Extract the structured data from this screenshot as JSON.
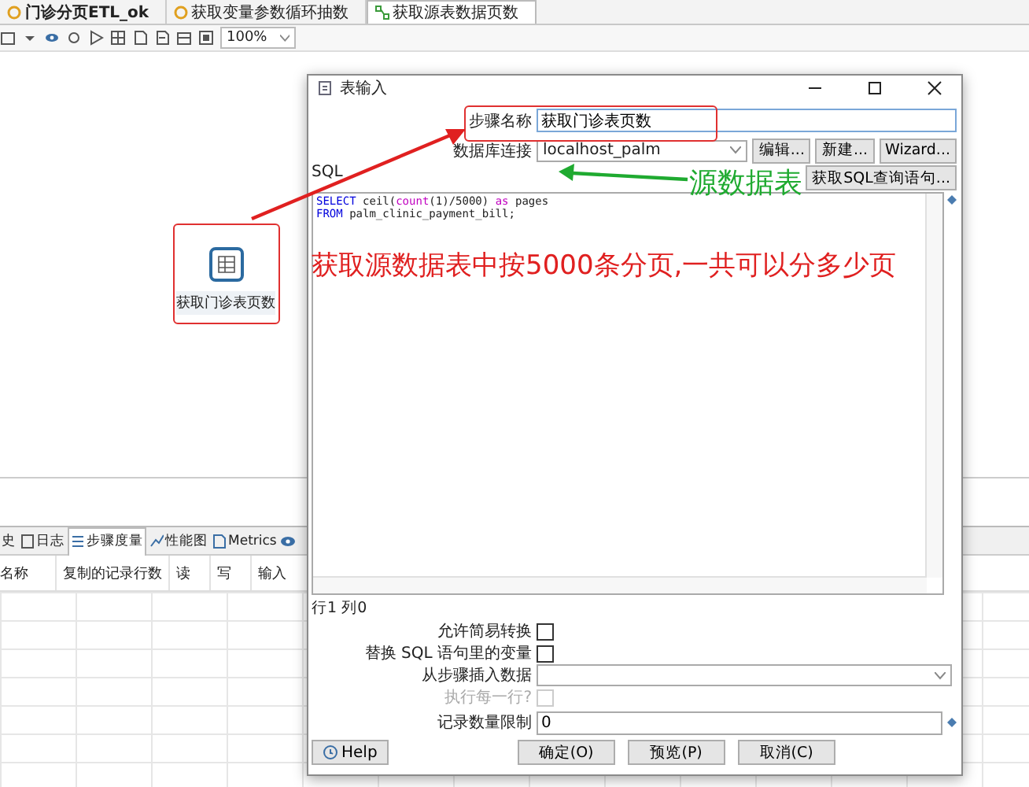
{
  "editor_tabs": [
    {
      "label": "门诊分页ETL_ok",
      "selected": false,
      "dirty": true
    },
    {
      "label": "获取变量参数循环抽数",
      "selected": false,
      "dirty": false
    },
    {
      "label": "获取源表数据页数",
      "selected": true,
      "dirty": false
    }
  ],
  "toolbar": {
    "zoom": "100%"
  },
  "canvas": {
    "step_label": "获取门诊表页数"
  },
  "bottom_panel": {
    "tabs": [
      {
        "label": "史",
        "selected": false
      },
      {
        "label": "日志",
        "selected": false
      },
      {
        "label": "步骤度量",
        "selected": true
      },
      {
        "label": "性能图",
        "selected": false
      },
      {
        "label": "Metrics",
        "selected": false
      }
    ],
    "columns": [
      "名称",
      "复制的记录行数",
      "读",
      "写",
      "输入"
    ]
  },
  "dialog": {
    "title": "表输入",
    "step_name": {
      "label": "步骤名称",
      "value": "获取门诊表页数"
    },
    "connection": {
      "label": "数据库连接",
      "value": "localhost_palm",
      "buttons": [
        "编辑...",
        "新建...",
        "Wizard..."
      ]
    },
    "sql_label": "SQL",
    "sql_button": "获取SQL查询语句...",
    "sql_lines": [
      [
        {
          "text": "SELECT",
          "kind": "keyword"
        },
        {
          "text": " ceil(",
          "kind": "plain"
        },
        {
          "text": "count",
          "kind": "function"
        },
        {
          "text": "(1)/5000) ",
          "kind": "plain"
        },
        {
          "text": "as",
          "kind": "function"
        },
        {
          "text": " pages",
          "kind": "plain"
        }
      ],
      [
        {
          "text": "FROM",
          "kind": "keyword"
        },
        {
          "text": " palm_clinic_payment_bill;",
          "kind": "plain"
        }
      ]
    ],
    "cursor": "行1 列0",
    "options": [
      {
        "kind": "checkbox",
        "label": "允许简易转换",
        "checked": false,
        "disabled": false
      },
      {
        "kind": "checkbox",
        "label": "替换 SQL 语句里的变量",
        "checked": false,
        "disabled": false
      },
      {
        "kind": "select",
        "label": "从步骤插入数据"
      },
      {
        "kind": "checkbox",
        "label": "执行每一行?",
        "checked": false,
        "disabled": true
      },
      {
        "kind": "text",
        "label": "记录数量限制",
        "value": "0"
      }
    ],
    "help": "Help",
    "buttons": [
      "确定(O)",
      "预览(P)",
      "取消(C)"
    ]
  },
  "annotations": {
    "note": "获取源数据表中按5000条分页,一共可以分多少页",
    "source_label": "源数据表"
  }
}
